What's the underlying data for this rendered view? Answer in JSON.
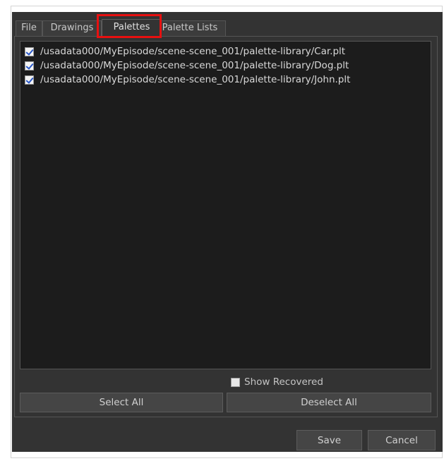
{
  "tabs": [
    {
      "label": "File"
    },
    {
      "label": "Drawings"
    },
    {
      "label": "Palettes"
    },
    {
      "label": "Palette Lists"
    }
  ],
  "active_tab": "Palettes",
  "palette_list": {
    "items": [
      {
        "path": "/usadata000/MyEpisode/scene-scene_001/palette-library/Car.plt",
        "checked": true
      },
      {
        "path": "/usadata000/MyEpisode/scene-scene_001/palette-library/Dog.plt",
        "checked": true
      },
      {
        "path": "/usadata000/MyEpisode/scene-scene_001/palette-library/John.plt",
        "checked": true
      }
    ]
  },
  "show_recovered": {
    "label": "Show Recovered",
    "checked": false
  },
  "buttons": {
    "select_all": "Select All",
    "deselect_all": "Deselect All",
    "save": "Save",
    "cancel": "Cancel"
  },
  "colors": {
    "dialog_bg": "#333333",
    "list_bg": "#1c1c1c",
    "highlight": "#e81010",
    "check": "#2a58c8"
  }
}
